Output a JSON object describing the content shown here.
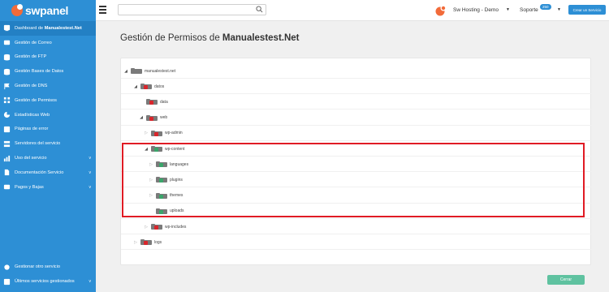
{
  "brand": {
    "name": "swpanel"
  },
  "sidebar": {
    "items": [
      {
        "pre": "Dashboard de ",
        "bold": "Manualestest.Net",
        "icon": "dashboard-icon",
        "active": true
      },
      {
        "label": "Gestión de Correo",
        "icon": "mail-icon"
      },
      {
        "label": "Gestión de FTP",
        "icon": "database-icon"
      },
      {
        "label": "Gestión Bases de Datos",
        "icon": "database-icon"
      },
      {
        "label": "Gestión de DNS",
        "icon": "flag-icon"
      },
      {
        "label": "Gestión de Permisos",
        "icon": "permissions-icon"
      },
      {
        "label": "Estadísticas Web",
        "icon": "pie-chart-icon"
      },
      {
        "label": "Páginas de error",
        "icon": "error-page-icon"
      },
      {
        "label": "Servidores del servicio",
        "icon": "servers-icon"
      },
      {
        "label": "Uso del servicio",
        "icon": "usage-icon",
        "chevron": "v"
      },
      {
        "label": "Documentación Servicio",
        "icon": "document-icon",
        "chevron": "v"
      },
      {
        "label": "Pagos y Bajas",
        "icon": "payments-icon",
        "chevron": "v"
      }
    ],
    "bottom": [
      {
        "label": "Gestionar otro servicio",
        "icon": "gear-icon"
      },
      {
        "label": "Últimos servicios gestionados",
        "icon": "history-icon",
        "chevron": "v"
      }
    ]
  },
  "topbar": {
    "search_value": "",
    "user_name": "Sw Hosting - Demo",
    "support_label": "Soporte",
    "support_badge": "250",
    "create_service": "Crear un Servicio"
  },
  "page": {
    "title_prefix": "Gestión de Permisos de ",
    "title_domain": "Manualestest.Net"
  },
  "tree": [
    {
      "label": "manualestest.net",
      "depth": 0,
      "arrow": "expanded",
      "mark": "none"
    },
    {
      "label": "datos",
      "depth": 1,
      "arrow": "expanded",
      "mark": "red"
    },
    {
      "label": "data",
      "depth": 2,
      "arrow": "none",
      "mark": "red"
    },
    {
      "label": "web",
      "depth": 2,
      "arrow": "expanded",
      "mark": "red"
    },
    {
      "label": "wp-admin",
      "depth": 3,
      "arrow": "collapsed",
      "mark": "red"
    },
    {
      "label": "wp-content",
      "depth": 3,
      "arrow": "expanded",
      "mark": "green"
    },
    {
      "label": "languages",
      "depth": 4,
      "arrow": "collapsed",
      "mark": "green"
    },
    {
      "label": "plugins",
      "depth": 4,
      "arrow": "collapsed",
      "mark": "green"
    },
    {
      "label": "themes",
      "depth": 4,
      "arrow": "collapsed",
      "mark": "green"
    },
    {
      "label": "uploads",
      "depth": 4,
      "arrow": "none",
      "mark": "green"
    },
    {
      "label": "wp-includes",
      "depth": 3,
      "arrow": "collapsed",
      "mark": "red"
    },
    {
      "label": "logs",
      "depth": 1,
      "arrow": "collapsed",
      "mark": "red"
    }
  ],
  "close_label": "Cerrar",
  "colors": {
    "sidebar": "#2d8fd5",
    "folder_gray": "#7a7a7a",
    "mark_red": "#d9262c",
    "mark_green": "#3aa56a",
    "highlight": "#e01b24",
    "close_button": "#5fc2a0"
  }
}
